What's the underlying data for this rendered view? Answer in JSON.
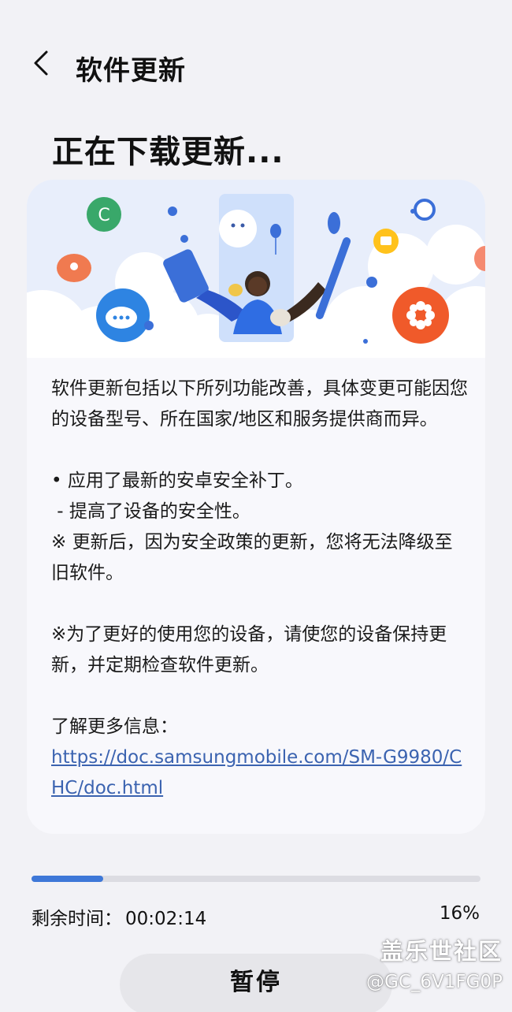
{
  "header": {
    "title": "软件更新"
  },
  "status": {
    "title": "正在下载更新..."
  },
  "content": {
    "intro": "软件更新包括以下所列功能改善，具体变更可能因您的设备型号、所在国家/地区和服务提供商而异。",
    "bullet": "• 应用了最新的安卓安全补丁。",
    "sub": " - 提高了设备的安全性。",
    "note": "※ 更新后，因为安全政策的更新，您将无法降级至旧软件。",
    "tip": "※为了更好的使用您的设备，请使您的设备保持更新，并定期检查软件更新。",
    "more_label": "了解更多信息：",
    "link": "https://doc.samsungmobile.com/SM-G9980/CHC/doc.html"
  },
  "progress": {
    "fraction": 0.16,
    "remaining_label": "剩余时间：",
    "remaining_time": "00:02:14",
    "percent": "16%"
  },
  "pause_button": "暂停",
  "watermark": {
    "line1": "盖乐世社区",
    "line2": "@GC_6V1FG0P"
  },
  "colors": {
    "accent": "#3e78d8",
    "link": "#3b63b0"
  }
}
